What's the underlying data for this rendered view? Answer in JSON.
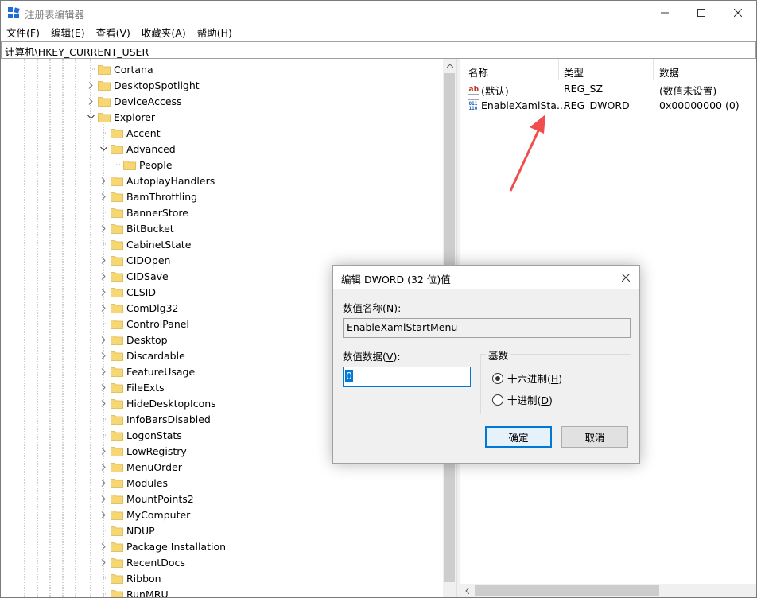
{
  "window": {
    "title": "注册表编辑器"
  },
  "menu": [
    "文件(F)",
    "编辑(E)",
    "查看(V)",
    "收藏夹(A)",
    "帮助(H)"
  ],
  "address": "计算机\\HKEY_CURRENT_USER",
  "tree": [
    {
      "label": "Cortana",
      "level": 0,
      "expander": "none"
    },
    {
      "label": "DesktopSpotlight",
      "level": 0,
      "expander": "collapsed"
    },
    {
      "label": "DeviceAccess",
      "level": 0,
      "expander": "collapsed"
    },
    {
      "label": "Explorer",
      "level": 0,
      "expander": "expanded"
    },
    {
      "label": "Accent",
      "level": 1,
      "expander": "none"
    },
    {
      "label": "Advanced",
      "level": 1,
      "expander": "expanded"
    },
    {
      "label": "People",
      "level": 2,
      "expander": "none"
    },
    {
      "label": "AutoplayHandlers",
      "level": 1,
      "expander": "collapsed"
    },
    {
      "label": "BamThrottling",
      "level": 1,
      "expander": "collapsed"
    },
    {
      "label": "BannerStore",
      "level": 1,
      "expander": "none"
    },
    {
      "label": "BitBucket",
      "level": 1,
      "expander": "collapsed"
    },
    {
      "label": "CabinetState",
      "level": 1,
      "expander": "none"
    },
    {
      "label": "CIDOpen",
      "level": 1,
      "expander": "collapsed"
    },
    {
      "label": "CIDSave",
      "level": 1,
      "expander": "collapsed"
    },
    {
      "label": "CLSID",
      "level": 1,
      "expander": "collapsed"
    },
    {
      "label": "ComDlg32",
      "level": 1,
      "expander": "collapsed"
    },
    {
      "label": "ControlPanel",
      "level": 1,
      "expander": "none"
    },
    {
      "label": "Desktop",
      "level": 1,
      "expander": "collapsed"
    },
    {
      "label": "Discardable",
      "level": 1,
      "expander": "collapsed"
    },
    {
      "label": "FeatureUsage",
      "level": 1,
      "expander": "collapsed"
    },
    {
      "label": "FileExts",
      "level": 1,
      "expander": "collapsed"
    },
    {
      "label": "HideDesktopIcons",
      "level": 1,
      "expander": "collapsed"
    },
    {
      "label": "InfoBarsDisabled",
      "level": 1,
      "expander": "none"
    },
    {
      "label": "LogonStats",
      "level": 1,
      "expander": "none"
    },
    {
      "label": "LowRegistry",
      "level": 1,
      "expander": "collapsed"
    },
    {
      "label": "MenuOrder",
      "level": 1,
      "expander": "collapsed"
    },
    {
      "label": "Modules",
      "level": 1,
      "expander": "collapsed"
    },
    {
      "label": "MountPoints2",
      "level": 1,
      "expander": "collapsed"
    },
    {
      "label": "MyComputer",
      "level": 1,
      "expander": "collapsed"
    },
    {
      "label": "NDUP",
      "level": 1,
      "expander": "none"
    },
    {
      "label": "Package Installation",
      "level": 1,
      "expander": "collapsed"
    },
    {
      "label": "RecentDocs",
      "level": 1,
      "expander": "collapsed"
    },
    {
      "label": "Ribbon",
      "level": 1,
      "expander": "none"
    },
    {
      "label": "RunMRU",
      "level": 1,
      "expander": "none"
    }
  ],
  "list": {
    "headers": {
      "name": "名称",
      "type": "类型",
      "data": "数据"
    },
    "rows": [
      {
        "icon": "string-value-icon",
        "name": "(默认)",
        "type": "REG_SZ",
        "data": "(数值未设置)"
      },
      {
        "icon": "binary-value-icon",
        "name": "EnableXamlSta...",
        "type": "REG_DWORD",
        "data": "0x00000000 (0)"
      }
    ]
  },
  "dialog": {
    "title": "编辑 DWORD (32 位)值",
    "name_label": "数值名称(",
    "name_label_key": "N",
    "name_label_end": "):",
    "name_value": "EnableXamlStartMenu",
    "data_label": "数值数据(",
    "data_label_key": "V",
    "data_label_end": "):",
    "data_value": "0",
    "base_label": "基数",
    "hex_label": "十六进制(",
    "hex_key": "H",
    "hex_end": ")",
    "dec_label": "十进制(",
    "dec_key": "D",
    "dec_end": ")",
    "selected_base": "hex",
    "ok": "确定",
    "cancel": "取消"
  },
  "colors": {
    "accent": "#0078d7",
    "folder": "#f7d774",
    "arrow": "#f04e4e"
  }
}
